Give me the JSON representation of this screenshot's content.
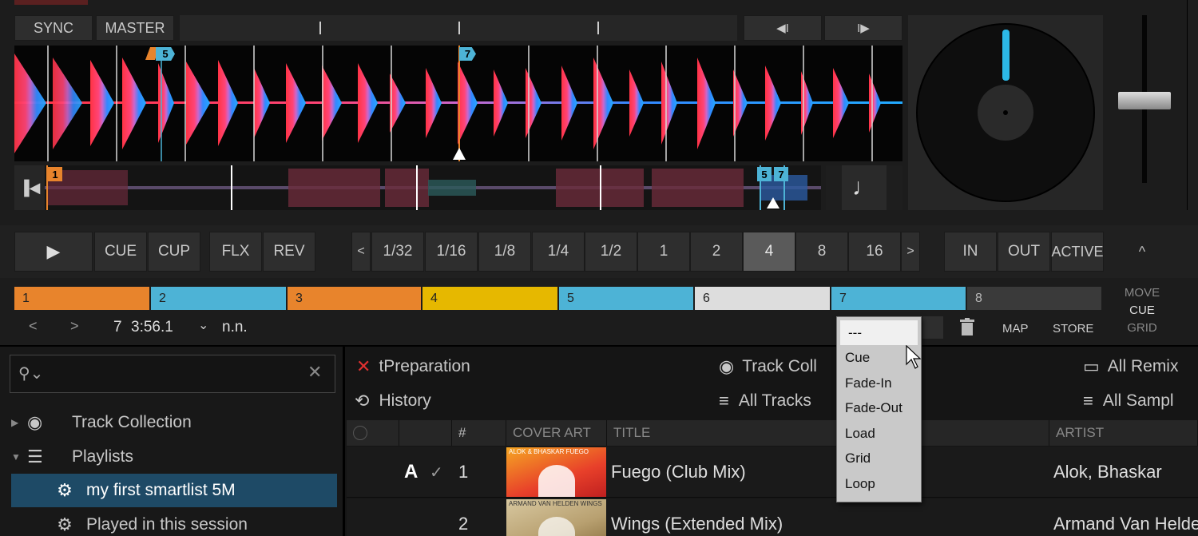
{
  "deck": {
    "sync_label": "SYNC",
    "master_label": "MASTER",
    "beatjump_back": "◀I",
    "beatjump_fwd": "I▶",
    "transport": {
      "play": "▶",
      "cue": "CUE",
      "cup": "CUP",
      "flx": "FLX",
      "rev": "REV"
    },
    "loop_sizes": [
      "1/32",
      "1/16",
      "1/8",
      "1/4",
      "1/2",
      "1",
      "2",
      "4",
      "8",
      "16"
    ],
    "loop_selected": "4",
    "loop_prev": "<",
    "loop_next": ">",
    "loop_in": "IN",
    "loop_out": "OUT",
    "loop_active": "ACTIVE",
    "collapse": "^",
    "wave_markers": {
      "cue_5": "5",
      "cue_7": "7"
    },
    "overview_markers": {
      "m1": "1",
      "m5": "5",
      "m7": "7"
    },
    "beat_symbol": "♩",
    "hotcues": [
      {
        "num": "1",
        "color": "#e8842c"
      },
      {
        "num": "2",
        "color": "#4db3d6"
      },
      {
        "num": "3",
        "color": "#e8842c"
      },
      {
        "num": "4",
        "color": "#e6b800"
      },
      {
        "num": "5",
        "color": "#4db3d6"
      },
      {
        "num": "6",
        "color": "#dddddd"
      },
      {
        "num": "7",
        "color": "#4db3d6"
      },
      {
        "num": "8",
        "color": "#3a3a3a"
      }
    ],
    "mode": {
      "move": "MOVE",
      "cue": "CUE",
      "grid": "GRID"
    },
    "cue_info": {
      "prev": "<",
      "next": ">",
      "number": "7",
      "time": "3:56.1",
      "chev": "⌄",
      "name": "n.n."
    },
    "map_label": "MAP",
    "store_label": "STORE"
  },
  "cue_type_menu": {
    "items": [
      "---",
      "Cue",
      "Fade-In",
      "Fade-Out",
      "Load",
      "Grid",
      "Loop"
    ],
    "selected": "---"
  },
  "browser": {
    "search": {
      "placeholder": ""
    },
    "tree": [
      {
        "label": "Track Collection",
        "arrow": "▶"
      },
      {
        "label": "Playlists",
        "arrow": "▼"
      },
      {
        "label": "my first smartlist 5M",
        "selected": true
      },
      {
        "label": "Played in this session"
      }
    ],
    "favorites": {
      "preparation": "tPreparation",
      "history": "History",
      "track_collection": "Track Coll",
      "all_tracks": "All Tracks",
      "all_remix": "All Remix",
      "all_samples": "All Sampl"
    },
    "columns": {
      "num": "#",
      "cover": "COVER ART",
      "title": "TITLE",
      "artist": "ARTIST"
    },
    "rows": [
      {
        "deck": "A",
        "num": "1",
        "title": "Fuego (Club Mix)",
        "artist": "Alok, Bhaskar",
        "cover_top": "ALOK & BHASKAR  FUEGO"
      },
      {
        "deck": "",
        "num": "2",
        "title": "Wings (Extended Mix)",
        "artist": "Armand Van Helden",
        "cover_top": "ARMAND VAN HELDEN  WINGS"
      }
    ]
  },
  "colors": {
    "accent_blue": "#1e4a66",
    "cue_orange": "#e8842c",
    "cue_blue": "#4db3d6"
  }
}
